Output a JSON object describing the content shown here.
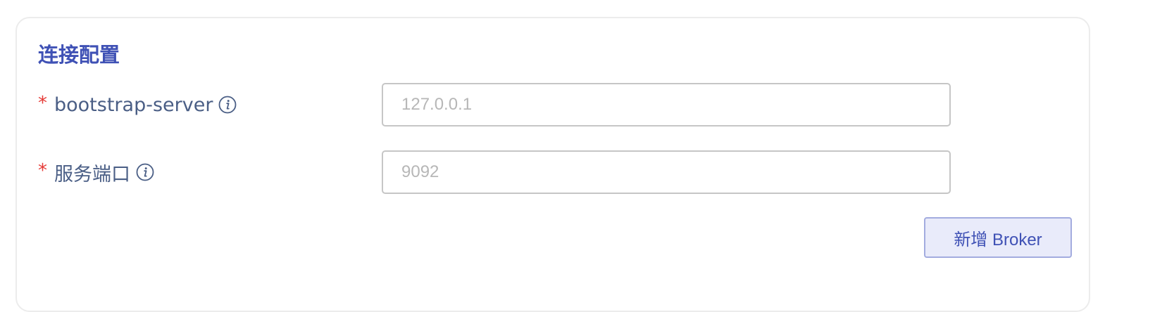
{
  "section": {
    "title": "连接配置"
  },
  "fields": [
    {
      "required_mark": "*",
      "label": "bootstrap-server",
      "icon": "info-icon",
      "value": "",
      "placeholder": "127.0.0.1"
    },
    {
      "required_mark": "*",
      "label": "服务端口",
      "icon": "info-icon",
      "value": "",
      "placeholder": "9092"
    }
  ],
  "actions": {
    "add_broker_label": "新增 Broker"
  },
  "colors": {
    "accent": "#3f51b5",
    "required": "#e53935",
    "label": "#4a5e85",
    "button_bg": "#e9ebfa",
    "button_border": "#a3acdf",
    "input_border": "#c6c6c6",
    "placeholder": "#b7b7b7"
  }
}
